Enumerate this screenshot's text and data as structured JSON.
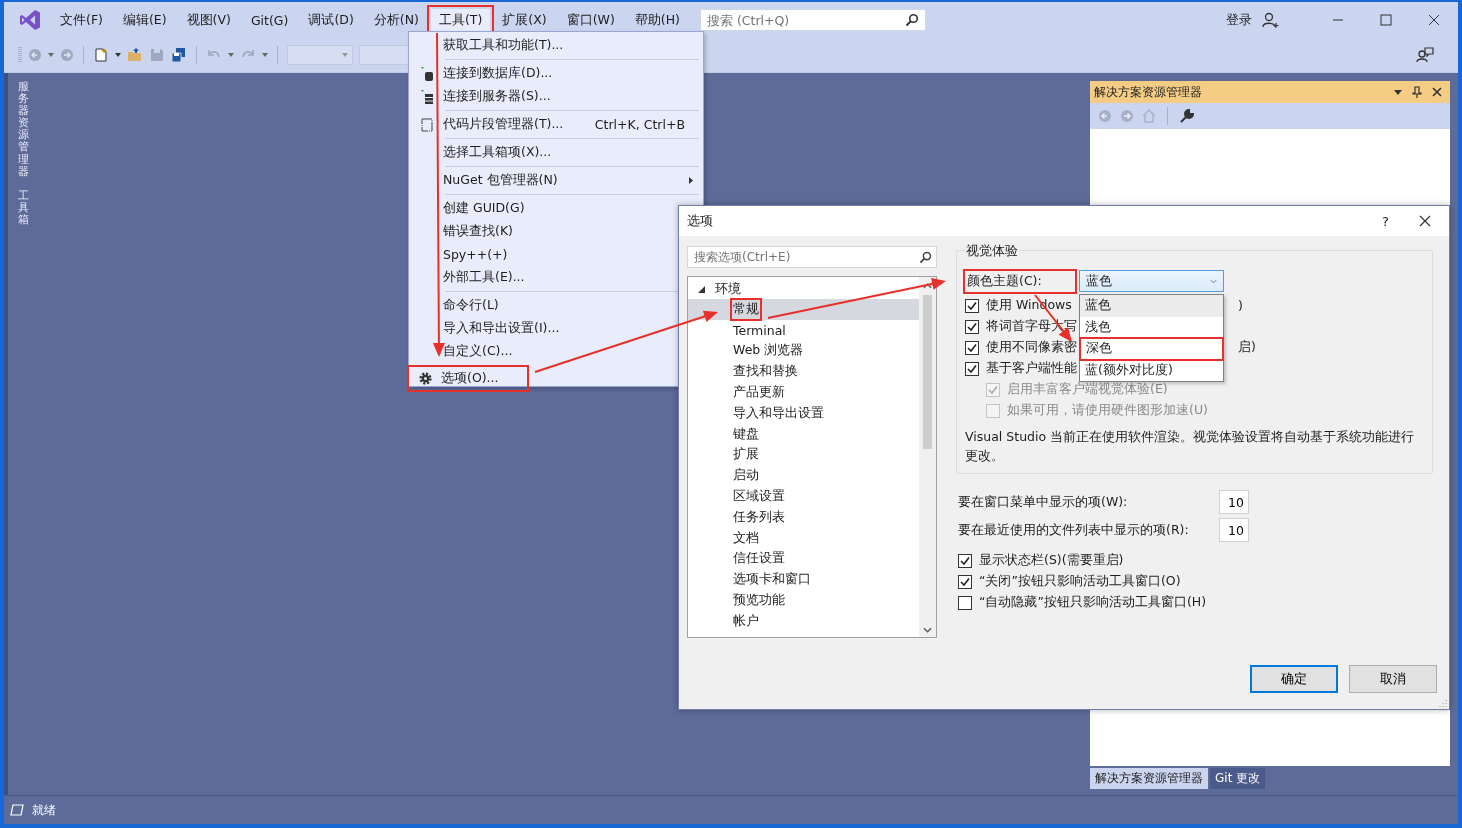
{
  "menu_bar": {
    "items": [
      {
        "label": "文件(F)",
        "selected": false,
        "highlighted": false
      },
      {
        "label": "编辑(E)",
        "selected": false,
        "highlighted": false
      },
      {
        "label": "视图(V)",
        "selected": false,
        "highlighted": false
      },
      {
        "label": "Git(G)",
        "selected": false,
        "highlighted": false
      },
      {
        "label": "调试(D)",
        "selected": false,
        "highlighted": false
      },
      {
        "label": "分析(N)",
        "selected": false,
        "highlighted": false
      },
      {
        "label": "工具(T)",
        "selected": true,
        "highlighted": true
      },
      {
        "label": "扩展(X)",
        "selected": false,
        "highlighted": false
      },
      {
        "label": "窗口(W)",
        "selected": false,
        "highlighted": false
      },
      {
        "label": "帮助(H)",
        "selected": false,
        "highlighted": false
      }
    ],
    "search": {
      "placeholder": "搜索 (Ctrl+Q)"
    },
    "sign_in": "登录"
  },
  "side_tabs": [
    {
      "label": "服务器资源管理器"
    },
    {
      "label": "工具箱"
    }
  ],
  "tools_menu": {
    "groups": [
      [
        {
          "label": "获取工具和功能(T)...",
          "kind": "plain",
          "highlighted": false
        }
      ],
      [
        {
          "label": "连接到数据库(D)...",
          "kind": "database",
          "highlighted": false
        },
        {
          "label": "连接到服务器(S)...",
          "kind": "server",
          "highlighted": false
        }
      ],
      [
        {
          "label": "代码片段管理器(T)...",
          "shortcut": "Ctrl+K, Ctrl+B",
          "kind": "snippet",
          "highlighted": false
        }
      ],
      [
        {
          "label": "选择工具箱项(X)...",
          "kind": "plain",
          "highlighted": false
        }
      ],
      [
        {
          "label": "NuGet 包管理器(N)",
          "kind": "submenu",
          "highlighted": false
        }
      ],
      [
        {
          "label": "创建 GUID(G)",
          "kind": "plain",
          "highlighted": false
        },
        {
          "label": "错误查找(K)",
          "kind": "plain",
          "highlighted": false
        },
        {
          "label": "Spy++(+)",
          "kind": "plain",
          "highlighted": false
        },
        {
          "label": "外部工具(E)...",
          "kind": "plain",
          "highlighted": false
        }
      ],
      [
        {
          "label": "命令行(L)",
          "kind": "plain",
          "highlighted": false
        },
        {
          "label": "导入和导出设置(I)...",
          "kind": "plain",
          "highlighted": false
        },
        {
          "label": "自定义(C)...",
          "kind": "plain",
          "highlighted": false
        },
        {
          "label": "选项(O)...",
          "kind": "gear",
          "highlighted": true
        }
      ]
    ]
  },
  "solution_explorer": {
    "title": "解决方案资源管理器",
    "tabs": [
      {
        "label": "解决方案资源管理器",
        "selected": true
      },
      {
        "label": "Git 更改",
        "selected": false
      }
    ]
  },
  "options_dialog": {
    "title": "选项",
    "help": "?",
    "search": {
      "placeholder": "搜索选项(Ctrl+E)"
    },
    "tree": [
      {
        "label": "环境",
        "expanded": true,
        "children": [
          {
            "label": "常规",
            "selected": true,
            "highlighted": true
          },
          {
            "label": "Terminal",
            "selected": false,
            "highlighted": false
          },
          {
            "label": "Web 浏览器",
            "selected": false,
            "highlighted": false
          },
          {
            "label": "查找和替换",
            "selected": false,
            "highlighted": false
          },
          {
            "label": "产品更新",
            "selected": false,
            "highlighted": false
          },
          {
            "label": "导入和导出设置",
            "selected": false,
            "highlighted": false
          },
          {
            "label": "键盘",
            "selected": false,
            "highlighted": false
          },
          {
            "label": "扩展",
            "selected": false,
            "highlighted": false
          },
          {
            "label": "启动",
            "selected": false,
            "highlighted": false
          },
          {
            "label": "区域设置",
            "selected": false,
            "highlighted": false
          },
          {
            "label": "任务列表",
            "selected": false,
            "highlighted": false
          },
          {
            "label": "文档",
            "selected": false,
            "highlighted": false
          },
          {
            "label": "信任设置",
            "selected": false,
            "highlighted": false
          },
          {
            "label": "选项卡和窗口",
            "selected": false,
            "highlighted": false
          },
          {
            "label": "预览功能",
            "selected": false,
            "highlighted": false
          },
          {
            "label": "帐户",
            "selected": false,
            "highlighted": false
          }
        ]
      }
    ],
    "visual_experience": {
      "legend": "视觉体验",
      "color_theme": {
        "label": "颜色主题(C):",
        "value": "蓝色",
        "highlighted": true,
        "expanded": true,
        "options": [
          {
            "label": "蓝色",
            "selected": true,
            "focused": false,
            "highlighted": false
          },
          {
            "label": "浅色",
            "selected": false,
            "focused": false,
            "highlighted": false
          },
          {
            "label": "深色",
            "selected": false,
            "focused": true,
            "highlighted": true
          },
          {
            "label": "蓝(额外对比度)",
            "selected": false,
            "focused": false,
            "highlighted": false
          }
        ]
      },
      "checkboxes": [
        {
          "label": "使用 Windows",
          "tail": ")",
          "checked": true,
          "disabled": false,
          "kind": "main"
        },
        {
          "label": "将词首字母大写",
          "checked": true,
          "disabled": false,
          "kind": "main"
        },
        {
          "label": "使用不同像素密",
          "tail": "启)",
          "checked": true,
          "disabled": false,
          "kind": "main"
        },
        {
          "label": "基于客户端性能",
          "checked": true,
          "disabled": false,
          "kind": "main"
        },
        {
          "label": "启用丰富客户端视觉体验(E)",
          "checked": true,
          "disabled": true,
          "kind": "sub"
        },
        {
          "label": "如果可用，请使用硬件图形加速(U)",
          "checked": false,
          "disabled": true,
          "kind": "sub"
        }
      ],
      "note": "Visual Studio 当前正在使用软件渲染。视觉体验设置将自动基于系统功能进行更改。"
    },
    "counts": [
      {
        "label": "要在窗口菜单中显示的项(W):",
        "value": "10"
      },
      {
        "label": "要在最近使用的文件列表中显示的项(R):",
        "value": "10"
      }
    ],
    "checkboxes": [
      {
        "label": "显示状态栏(S)(需要重启)",
        "checked": true
      },
      {
        "label": "“关闭”按钮只影响活动工具窗口(O)",
        "checked": true
      },
      {
        "label": "“自动隐藏”按钮只影响活动工具窗口(H)",
        "checked": false
      }
    ],
    "buttons": [
      {
        "label": "确定",
        "kind": "default"
      },
      {
        "label": "取消",
        "kind": "normal"
      }
    ]
  },
  "status_bar": {
    "text": "就绪"
  }
}
